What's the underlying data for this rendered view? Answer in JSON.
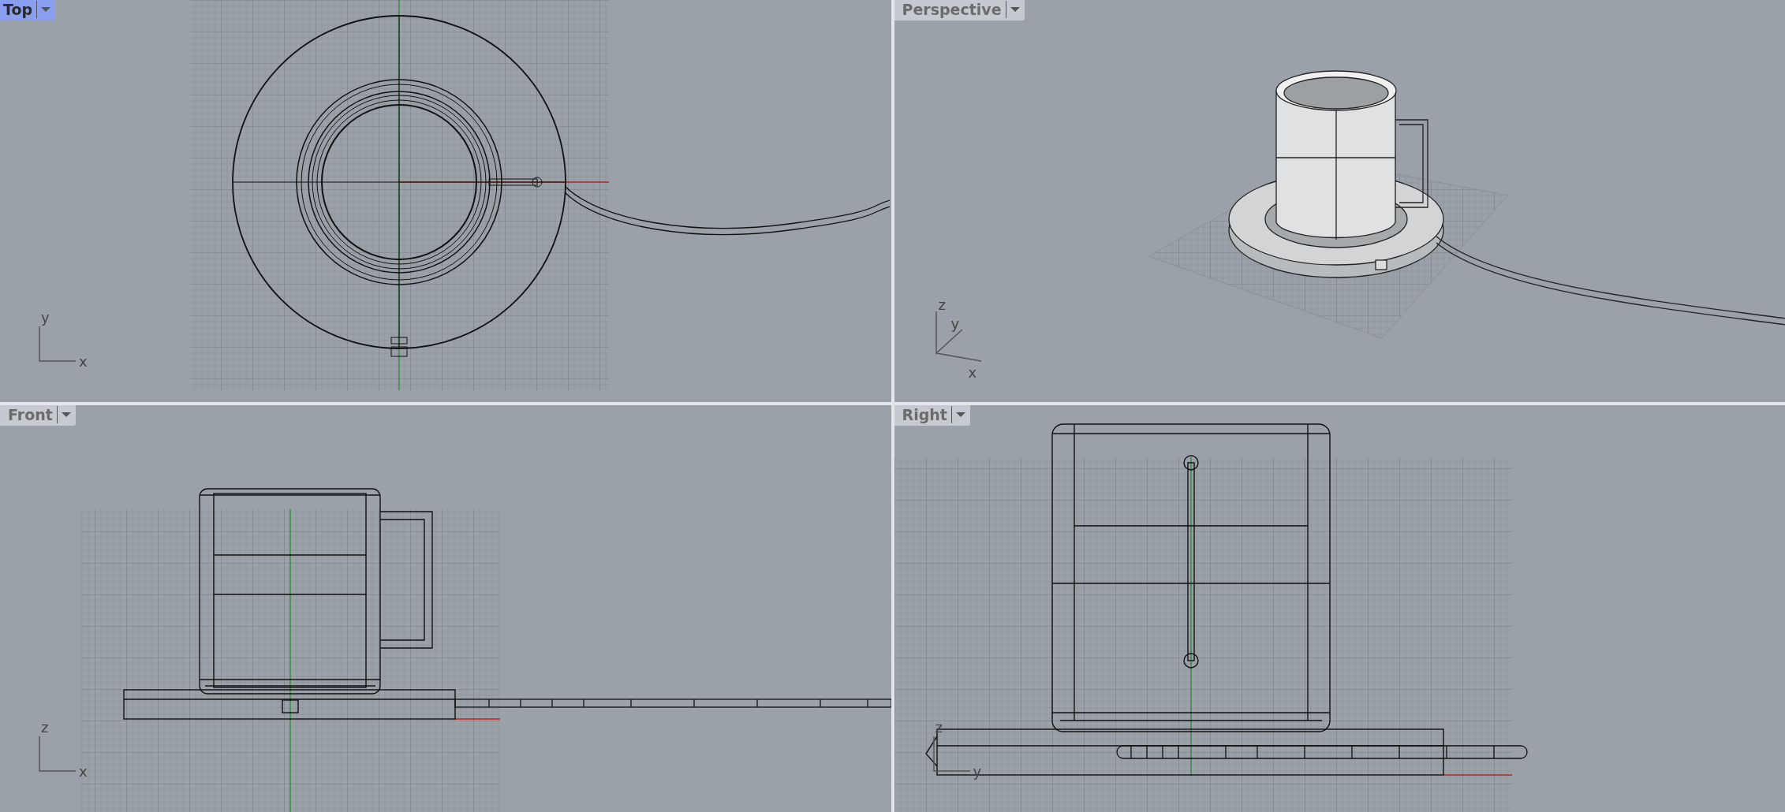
{
  "viewports": [
    {
      "kind": "top",
      "title": "Top",
      "selected": true,
      "axes": [
        "y",
        "x"
      ]
    },
    {
      "kind": "perspective",
      "title": "Perspective",
      "selected": false,
      "axes": [
        "z",
        "y",
        "x"
      ]
    },
    {
      "kind": "front",
      "title": "Front",
      "selected": false,
      "axes": [
        "z",
        "x"
      ]
    },
    {
      "kind": "right",
      "title": "Right",
      "selected": false,
      "axes": [
        "z",
        "y"
      ]
    }
  ]
}
